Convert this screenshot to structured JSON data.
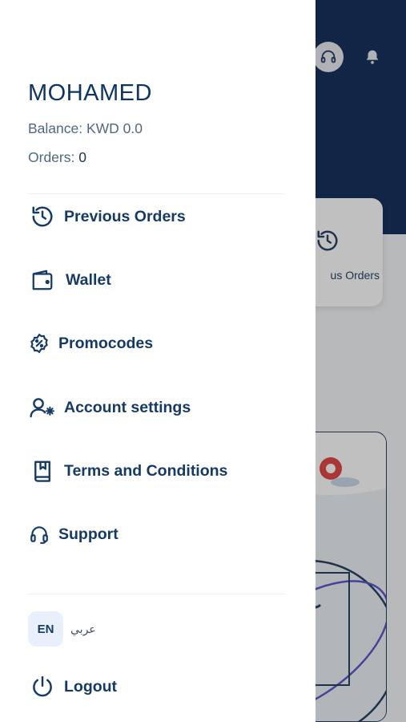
{
  "background": {
    "card_label": "us Orders"
  },
  "drawer": {
    "user_name": "MOHAMED",
    "balance_label": "Balance: KWD 0.0",
    "orders_label": "Orders:",
    "orders_count": "0",
    "menu": [
      {
        "label": "Previous Orders",
        "icon": "history-icon"
      },
      {
        "label": "Wallet",
        "icon": "wallet-icon"
      },
      {
        "label": "Promocodes",
        "icon": "promo-percent-icon"
      },
      {
        "label": "Account settings",
        "icon": "user-settings-icon"
      },
      {
        "label": "Terms and Conditions",
        "icon": "book-icon"
      },
      {
        "label": "Support",
        "icon": "headset-icon"
      }
    ],
    "language": {
      "en": "EN",
      "ar": "عربي"
    },
    "logout_label": "Logout"
  },
  "colors": {
    "primary": "#0f3464",
    "header_bg": "#0d2a57",
    "muted_text": "#4f6785"
  }
}
